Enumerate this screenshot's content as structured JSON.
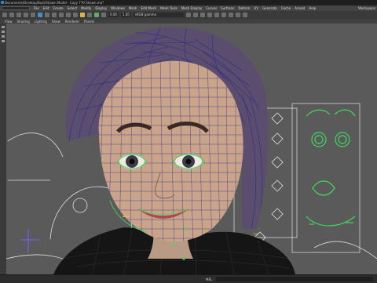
{
  "app": {
    "window_title": "Documents/Desktop/Bust/Shawn Model - Copy 770 Shawn.ma*",
    "workspace_label": "Workspace"
  },
  "menu": {
    "items": [
      "File",
      "Edit",
      "Create",
      "Select",
      "Modify",
      "Display",
      "Windows",
      "Mesh",
      "Edit Mesh",
      "Mesh Tools",
      "Mesh Display",
      "Curves",
      "Surfaces",
      "Deform",
      "UV",
      "Generate",
      "Cache",
      "Arnold",
      "Help"
    ]
  },
  "toolbar": {
    "value_a": "0.00",
    "value_b": "1.00",
    "renderer_field": "sRGB gamma"
  },
  "panel_menu": {
    "items": [
      "View",
      "Shading",
      "Lighting",
      "Show",
      "Renderer",
      "Panels"
    ]
  },
  "status_bar": {
    "mel_label": "MEL"
  },
  "colors": {
    "viewport_bg": "#5a5a5a",
    "wire_blue": "#2b2a8c",
    "ctrl_green": "#40d860",
    "curve_white": "#dedede"
  }
}
